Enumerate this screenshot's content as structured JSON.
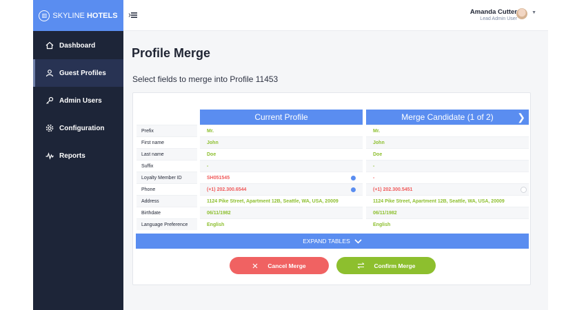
{
  "brand": {
    "word1": "SKYLINE",
    "word2": " HOTELS",
    "logo": "building-logo"
  },
  "sidebar": {
    "items": [
      {
        "label": "Dashboard",
        "icon": "home-icon",
        "active": false
      },
      {
        "label": "Guest Profiles",
        "icon": "user-icon",
        "active": true
      },
      {
        "label": "Admin Users",
        "icon": "key-icon",
        "active": false
      },
      {
        "label": "Configuration",
        "icon": "gear-icon",
        "active": false
      },
      {
        "label": "Reports",
        "icon": "chart-line-icon",
        "active": false
      }
    ]
  },
  "header": {
    "menu_icon": "≡",
    "user_name": "Amanda Cutter",
    "user_role": "Lead Admin User"
  },
  "page": {
    "title": "Profile Merge",
    "subtitle": "Select fields to merge into Profile 11453"
  },
  "fields": [
    "Prefix",
    "First name",
    "Last name",
    "Suffix",
    "Loyalty Member ID",
    "Phone",
    "Address",
    "Birthdate",
    "Language Preference"
  ],
  "current_profile": {
    "title": "Current Profile",
    "values": [
      "Mr.",
      "John",
      "Doe",
      "-",
      "SH051545",
      "(+1) 202.300.6544",
      "1124 Pike Street, Apartment 12B, Seattle, WA, USA, 20009",
      "06/11/1982",
      "English"
    ]
  },
  "merge_candidate": {
    "title": "Merge Candidate (1 of 2)",
    "values": [
      "Mr.",
      "John",
      "Doe",
      "-",
      "-",
      "(+1) 202.300.5451",
      "1124 Pike Street, Apartment 12B, Seattle, WA, USA, 20009",
      "06/11/1982",
      "English"
    ]
  },
  "actions": {
    "expand": "EXPAND TABLES",
    "cancel": "Cancel Merge",
    "confirm": "Confirm Merge"
  },
  "colors": {
    "accent": "#5a8df0",
    "sidebar": "#1d2538",
    "match": "#8dbf2e",
    "conflict": "#f05a5a"
  }
}
